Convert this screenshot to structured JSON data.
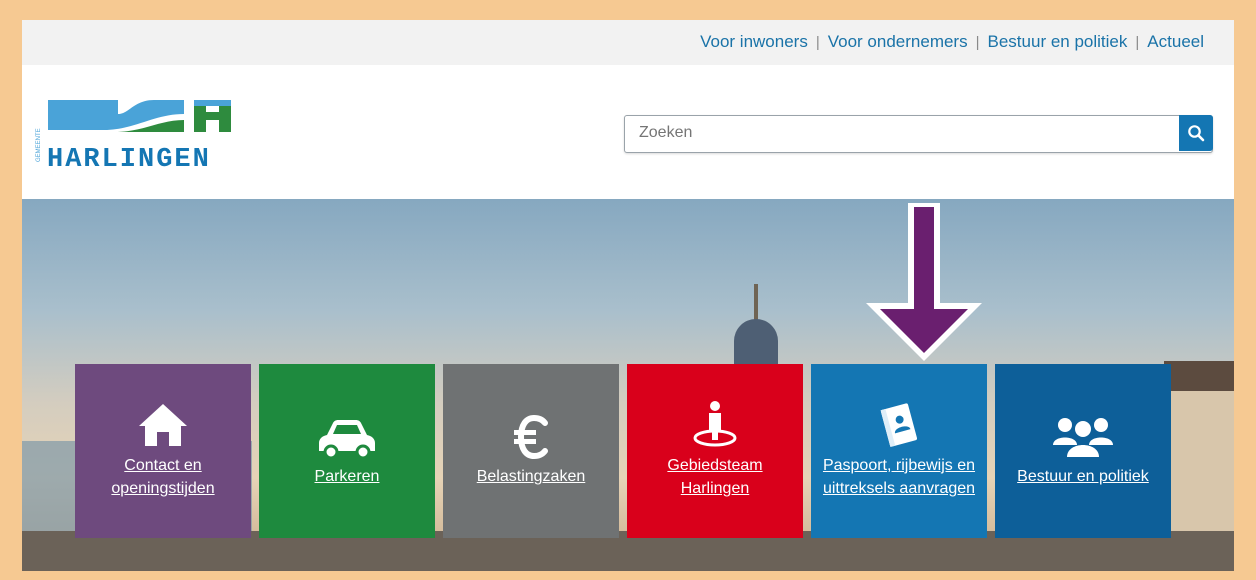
{
  "topnav": {
    "items": [
      "Voor inwoners",
      "Voor ondernemers",
      "Bestuur en politiek",
      "Actueel"
    ],
    "separator": "|"
  },
  "logo": {
    "small_text": "GEMEENTE",
    "name": "HARLINGEN"
  },
  "search": {
    "placeholder": "Zoeken"
  },
  "colors": {
    "accent_blue": "#1476b3",
    "tile_contact": "#6e4a7e",
    "tile_parkeren": "#1e8a3e",
    "tile_belasting": "#6f7273",
    "tile_gebiedsteam": "#d9001b",
    "tile_paspoort": "#1476b3",
    "tile_bestuur": "#0d5f99",
    "arrow": "#6a1f6f"
  },
  "tiles": [
    {
      "label": "Contact en openingstijden",
      "icon": "home-icon"
    },
    {
      "label": "Parkeren",
      "icon": "car-icon"
    },
    {
      "label": "Belastingzaken",
      "icon": "euro-icon"
    },
    {
      "label": "Gebiedsteam Harlingen",
      "icon": "person-location-icon"
    },
    {
      "label": "Paspoort, rijbewijs en uittreksels aanvragen",
      "icon": "passport-icon"
    },
    {
      "label": "Bestuur en politiek",
      "icon": "group-icon"
    }
  ]
}
